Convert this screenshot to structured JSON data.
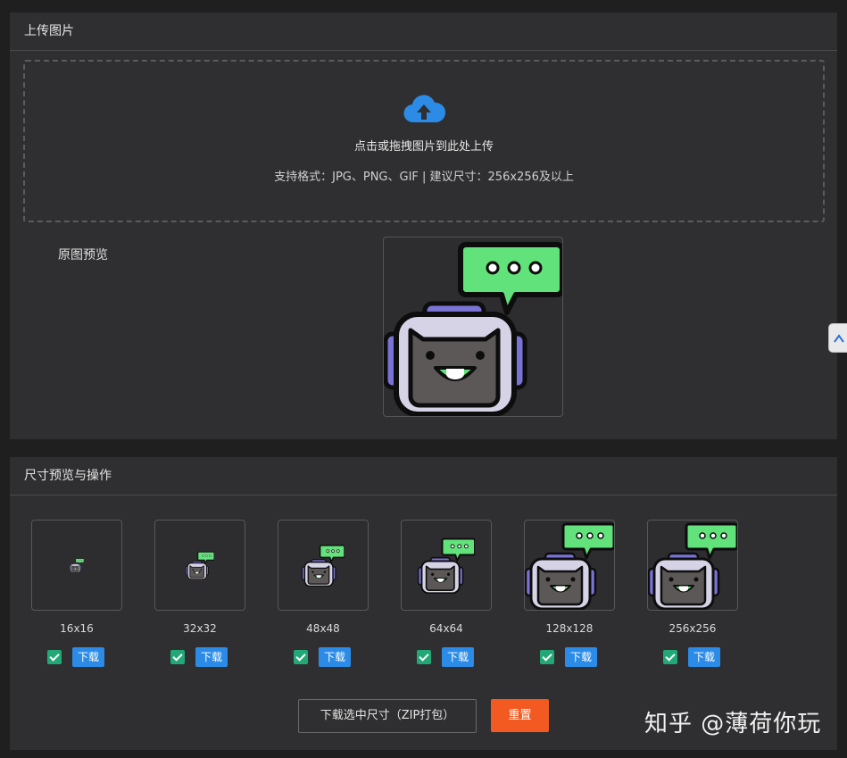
{
  "upload": {
    "title": "上传图片",
    "drop_title": "点击或拖拽图片到此处上传",
    "drop_hint": "支持格式：JPG、PNG、GIF | 建议尺寸：256x256及以上",
    "preview_label": "原图预览",
    "icon": "cloud-upload-icon"
  },
  "sizes": {
    "title": "尺寸预览与操作",
    "items": [
      {
        "label": "16x16",
        "checked": true,
        "download": "下载"
      },
      {
        "label": "32x32",
        "checked": true,
        "download": "下载"
      },
      {
        "label": "48x48",
        "checked": true,
        "download": "下载"
      },
      {
        "label": "64x64",
        "checked": true,
        "download": "下载"
      },
      {
        "label": "128x128",
        "checked": true,
        "download": "下载"
      },
      {
        "label": "256x256",
        "checked": true,
        "download": "下载"
      }
    ],
    "zip_button": "下载选中尺寸（ZIP打包）",
    "reset_button": "重置"
  },
  "watermark": "知乎 @薄荷你玩",
  "colors": {
    "accent_blue": "#2b8be6",
    "reset_orange": "#f25a22",
    "check_green": "#22a877",
    "bubble_green": "#5fe07a",
    "robot_purple": "#7a73d6"
  }
}
